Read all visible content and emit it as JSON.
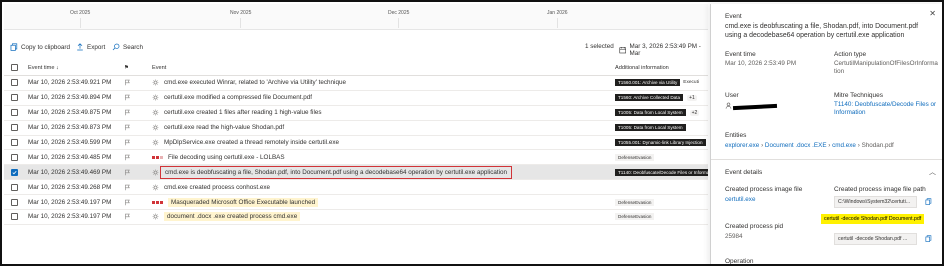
{
  "timeline": {
    "months": [
      "Oct 2025",
      "Nov 2025",
      "Dec 2025",
      "Jan 2026"
    ]
  },
  "toolbar": {
    "copy_label": "Copy to clipboard",
    "export_label": "Export",
    "search_label": "Search",
    "selected_label": "1 selected",
    "daterange_label": "Mar 3, 2026 2:53:49 PM - Mar"
  },
  "table": {
    "headers": {
      "time": "Event time ↓",
      "flag": "⚑",
      "event": "Event",
      "info": "Additional information"
    },
    "rows": [
      {
        "time": "Mar 10, 2026 2:53:49.921 PM",
        "event": "cmd.exe executed Winrar, related to 'Archive via Utility' technique",
        "tag": "T1560.001: Archive via Utility",
        "extra": "Executi",
        "style": "plain"
      },
      {
        "time": "Mar 10, 2026 2:53:49.894 PM",
        "event": "certutil.exe modified a compressed file Document.pdf",
        "tag": "T1560: Archive Collected Data",
        "plus": "+1",
        "style": "plain"
      },
      {
        "time": "Mar 10, 2026 2:53:49.875 PM",
        "event": "certutil.exe created 1 files after reading 1 high-value files",
        "tag": "T1005: Data from Local System",
        "plus": "+2",
        "style": "plain"
      },
      {
        "time": "Mar 10, 2026 2:53:49.873 PM",
        "event": "certutil.exe read the high-value Shodan.pdf",
        "tag": "T1005: Data from Local System",
        "style": "plain"
      },
      {
        "time": "Mar 10, 2026 2:53:49.599 PM",
        "event": "MpDlpService.exe created a thread remotely inside certutil.exe",
        "tag": "T1055.001: Dynamic-link Library Injection",
        "style": "plain"
      },
      {
        "time": "Mar 10, 2026 2:53:49.485 PM",
        "event": "File decoding using certutil.exe - LOLBAS",
        "tag": "DefenseEvasion",
        "style": "alert"
      },
      {
        "time": "Mar 10, 2026 2:53:49.469 PM",
        "event": "cmd.exe is deobfuscating a file, Shodan.pdf, into Document.pdf using a decodebase64 operation by certutil.exe application",
        "tag": "T1140: Deobfuscate/Decode Files or Information",
        "style": "selected"
      },
      {
        "time": "Mar 10, 2026 2:53:49.268 PM",
        "event": "cmd.exe created process conhost.exe",
        "tag": "",
        "style": "plain"
      },
      {
        "time": "Mar 10, 2026 2:53:49.197 PM",
        "event": "Masqueraded Microsoft Office Executable launched",
        "tag": "DefenseEvasion",
        "style": "alert-hl"
      },
      {
        "time": "Mar 10, 2026 2:53:49.197 PM",
        "event": "document .docx .exe created process cmd.exe",
        "tag": "DefenseEvasion",
        "style": "hl"
      }
    ]
  },
  "panel": {
    "type_label": "Event",
    "title": "cmd.exe is deobfuscating a file, Shodan.pdf, into Document.pdf using a decodebase64 operation by certutil.exe application",
    "event_time_label": "Event time",
    "event_time_value": "Mar 10, 2026 2:53:49 PM",
    "action_type_label": "Action type",
    "action_type_value": "CertutilManipulationOfFilesOrInformation",
    "user_label": "User",
    "mitre_label": "Mitre Techniques",
    "mitre_value": "T1140: Deobfuscate/Decode Files or Information",
    "entities_label": "Entities",
    "entities": [
      "explorer.exe",
      "Document .docx .EXE",
      "cmd.exe",
      "Shodan.pdf"
    ],
    "event_details_label": "Event details",
    "created_image_file_label": "Created process image file",
    "created_image_file_value": "certutil.exe",
    "created_image_path_label": "Created process image file path",
    "created_image_path_value": "C:\\Windows\\System32\\certuti...",
    "cmdline_highlight": "certutil -decode Shodan.pdf Document.pdf",
    "created_pid_label": "Created process pid",
    "created_pid_value": "25984",
    "cmdline_value": "certutil -decode Shodan.pdf ...",
    "operation_label": "Operation"
  },
  "colors": {
    "accent": "#0f6cbd",
    "alert": "#d13438",
    "highlight": "#fff4ce",
    "yellow": "#fff100"
  }
}
